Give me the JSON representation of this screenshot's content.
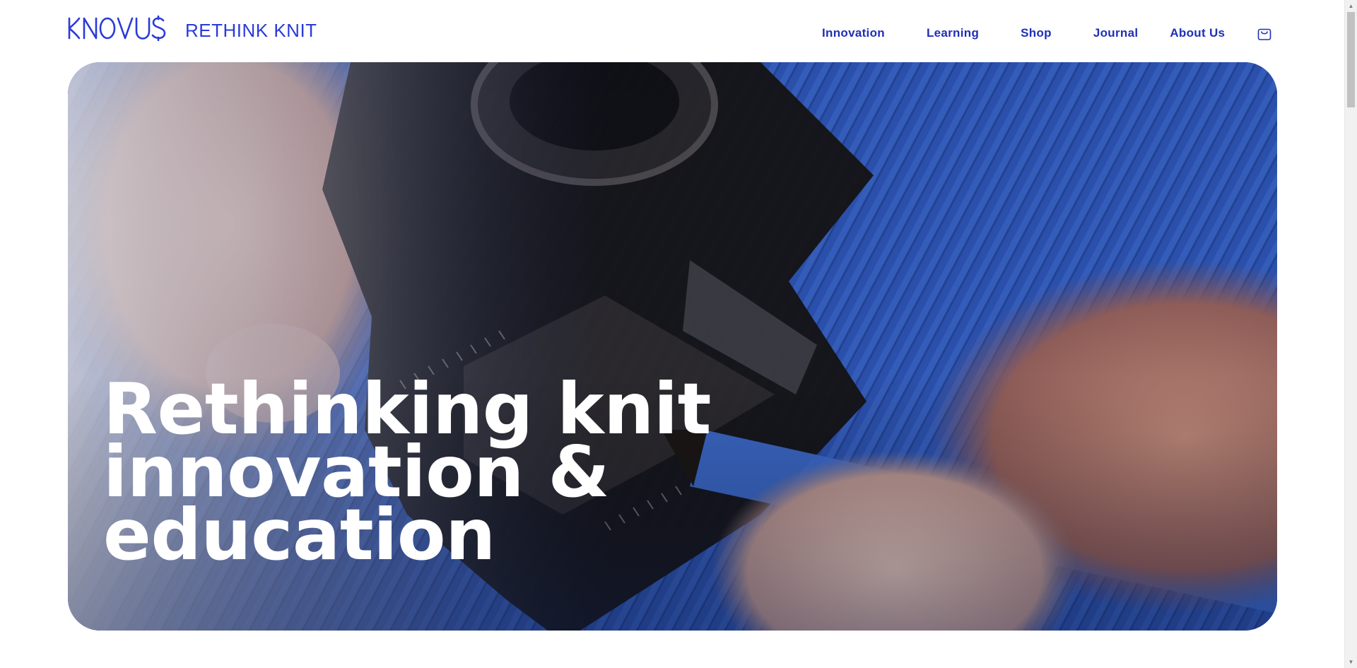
{
  "header": {
    "logo": {
      "wordmark": "KNOVUS",
      "tagline": "RETHINK KNIT"
    },
    "nav": [
      {
        "label": "Innovation"
      },
      {
        "label": "Learning"
      },
      {
        "label": "Shop"
      },
      {
        "label": "Journal"
      },
      {
        "label": "About Us"
      }
    ],
    "cart_icon": "shopping-bag-icon"
  },
  "hero": {
    "title_lines": [
      "Rethinking knit",
      "innovation &",
      "education"
    ],
    "image": "person inspecting blue knit fabric through a linen tester magnifier with a pencil"
  },
  "colors": {
    "brand": "#2a3bd8",
    "nav_text": "#1f2fb8",
    "hero_text": "#ffffff",
    "fabric_blue": "#2c4fa6"
  }
}
